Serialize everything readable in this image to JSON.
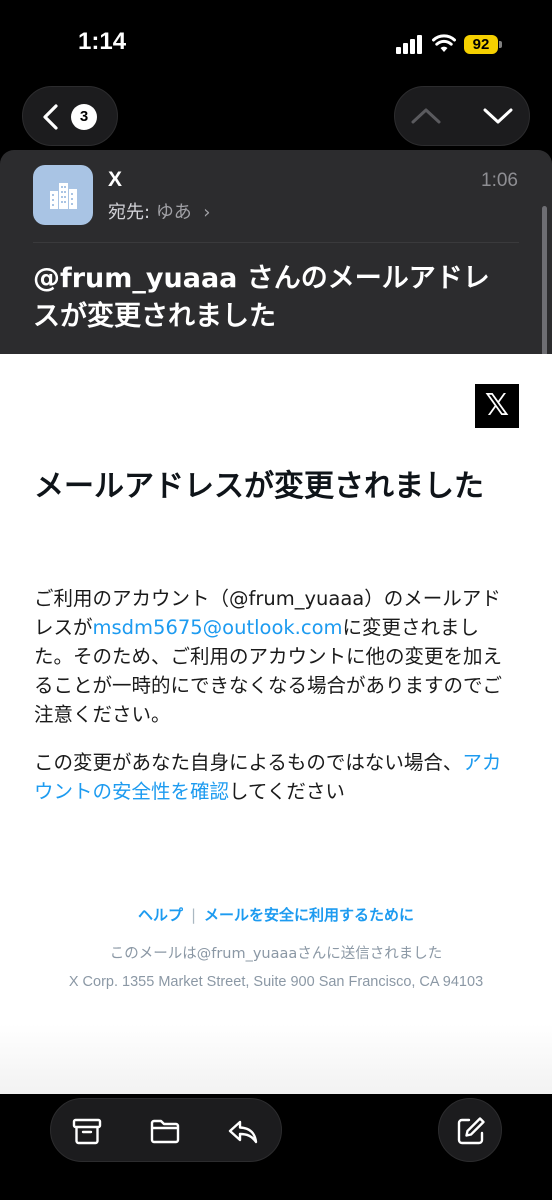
{
  "status_bar": {
    "time": "1:14",
    "battery": "92"
  },
  "nav": {
    "unread_count": "3"
  },
  "header": {
    "sender": "X",
    "recipient_label": "宛先:",
    "recipient": "ゆあ",
    "time": "1:06",
    "subject": "@frum_yuaaa さんのメールアドレスが変更されました"
  },
  "body": {
    "logo": "𝕏",
    "title": "メールアドレスが変更されました",
    "para1_a": "ご利用のアカウント（@frum_yuaaa）のメールアドレスが",
    "para1_email": "msdm5675@outlook.com",
    "para1_b": "に変更されました。そのため、ご利用のアカウントに他の変更を加えることが一時的にできなくなる場合がありますのでご注意ください。",
    "para2_a": "この変更があなた自身によるものではない場合、",
    "para2_link": "アカウントの安全性を確認",
    "para2_b": "してください",
    "footer_help": "ヘルプ",
    "footer_separator": "|",
    "footer_safety": "メールを安全に利用するために",
    "footer_sent": "このメールは@frum_yuaaaさんに送信されました",
    "footer_address": "X Corp. 1355 Market Street, Suite 900 San Francisco, CA 94103"
  },
  "toolbar": {
    "icons": [
      "archive-icon",
      "folder-icon",
      "reply-icon",
      "compose-icon"
    ]
  },
  "colors": {
    "link": "#1d9bf0",
    "battery": "#f5d000",
    "avatar": "#a9c4e4"
  }
}
